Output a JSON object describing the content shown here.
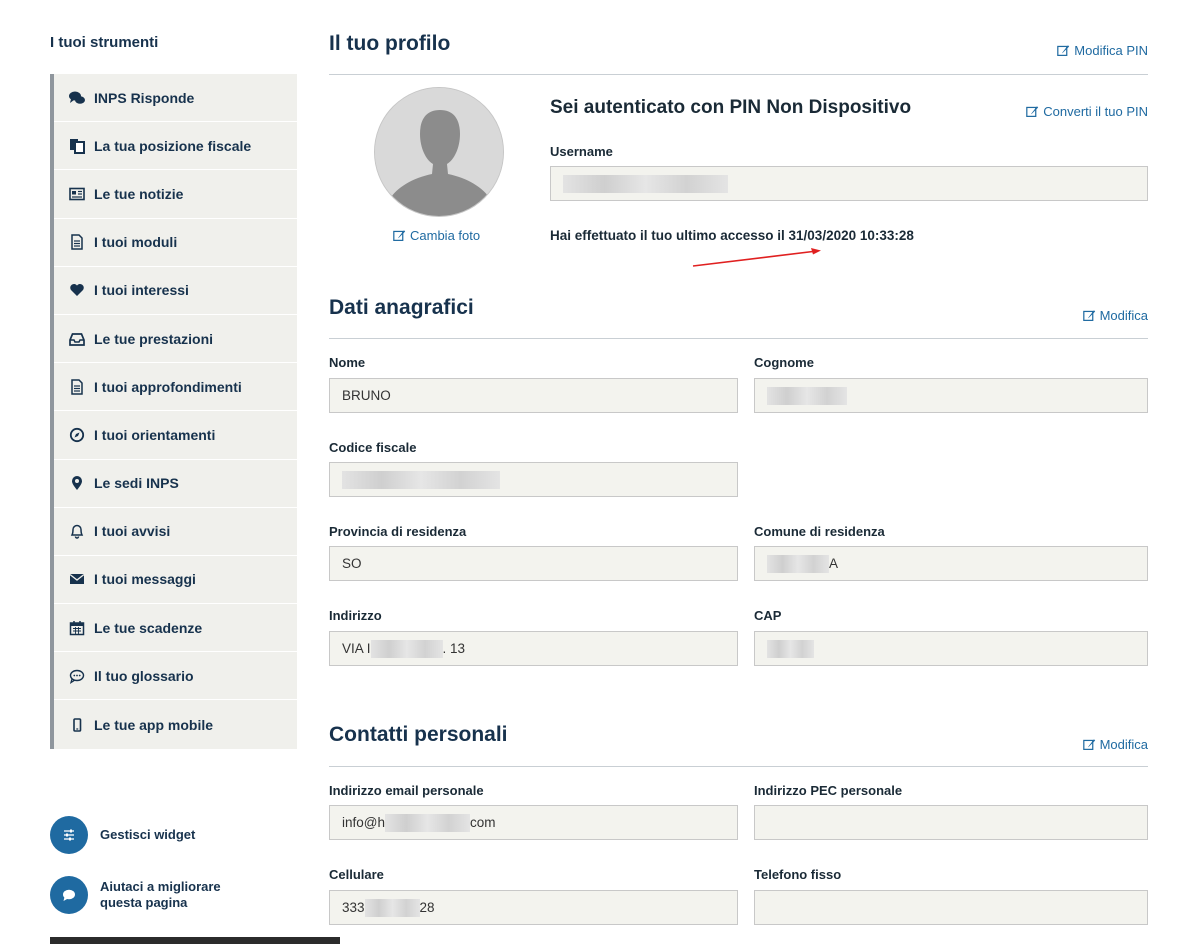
{
  "sidebar": {
    "title": "I tuoi strumenti",
    "items": [
      {
        "label": "INPS Risponde",
        "icon": "chat-bubbles-icon"
      },
      {
        "label": "La tua posizione fiscale",
        "icon": "documents-icon"
      },
      {
        "label": "Le tue notizie",
        "icon": "newspaper-icon"
      },
      {
        "label": "I tuoi moduli",
        "icon": "file-text-icon"
      },
      {
        "label": "I tuoi interessi",
        "icon": "heart-icon"
      },
      {
        "label": "Le tue prestazioni",
        "icon": "inbox-icon"
      },
      {
        "label": "I tuoi approfondimenti",
        "icon": "file-text-icon"
      },
      {
        "label": "I tuoi orientamenti",
        "icon": "compass-icon"
      },
      {
        "label": "Le sedi INPS",
        "icon": "map-marker-icon"
      },
      {
        "label": "I tuoi avvisi",
        "icon": "bell-icon"
      },
      {
        "label": "I tuoi messaggi",
        "icon": "envelope-icon"
      },
      {
        "label": "Le tue scadenze",
        "icon": "calendar-icon"
      },
      {
        "label": "Il tuo glossario",
        "icon": "comment-dots-icon"
      },
      {
        "label": "Le tue app mobile",
        "icon": "mobile-icon"
      }
    ],
    "widgets": [
      {
        "label": "Gestisci widget",
        "icon": "sliders-icon"
      },
      {
        "label": "Aiutaci a migliorare questa pagina",
        "icon": "speech-bubble-icon"
      }
    ]
  },
  "profile": {
    "title": "Il tuo profilo",
    "modify_pin": "Modifica PIN",
    "auth_heading": "Sei autenticato con PIN Non Dispositivo",
    "convert_pin": "Converti il tuo PIN",
    "username_label": "Username",
    "username_value": "",
    "change_photo": "Cambia foto",
    "last_access": "Hai effettuato il tuo ultimo accesso il 31/03/2020 10:33:28"
  },
  "anagrafici": {
    "title": "Dati anagrafici",
    "modify": "Modifica",
    "nome_label": "Nome",
    "nome_value": "BRUNO",
    "cognome_label": "Cognome",
    "cf_label": "Codice fiscale",
    "provincia_label": "Provincia di residenza",
    "provincia_value": "SO",
    "comune_label": "Comune di residenza",
    "comune_suffix": "A",
    "indirizzo_label": "Indirizzo",
    "indirizzo_prefix": "VIA I",
    "indirizzo_suffix": ". 13",
    "cap_label": "CAP"
  },
  "contatti": {
    "title": "Contatti personali",
    "modify": "Modifica",
    "email_label": "Indirizzo email personale",
    "email_prefix": "info@h",
    "email_suffix": "com",
    "pec_label": "Indirizzo PEC personale",
    "cell_label": "Cellulare",
    "cell_prefix": "333",
    "cell_suffix": "28",
    "tel_label": "Telefono fisso"
  },
  "colors": {
    "accent": "#1f6aa1",
    "heading": "#17324d",
    "sidebar_bg": "#f0f0ec",
    "annotation_arrow": "#e02020"
  }
}
